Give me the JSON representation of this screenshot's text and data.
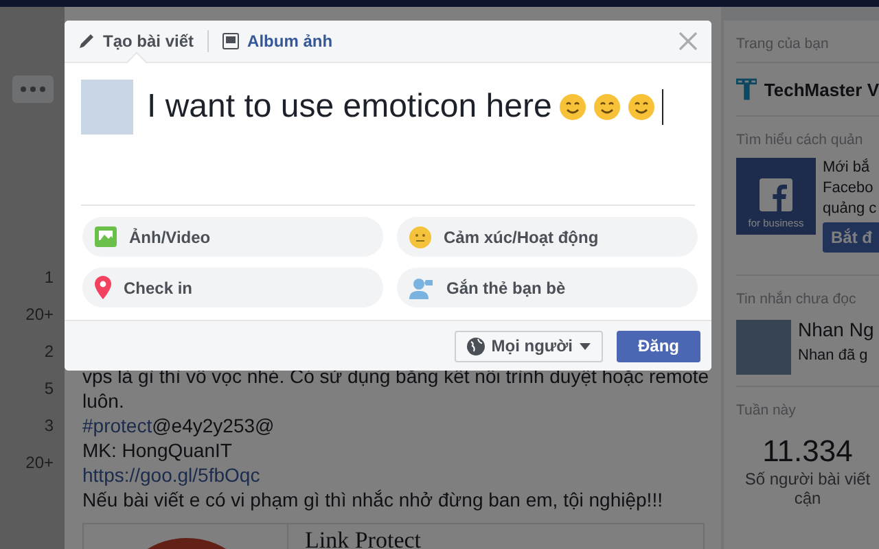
{
  "left_column": {
    "counts": [
      "1",
      "20+",
      "2",
      "5",
      "3",
      "20+"
    ]
  },
  "post": {
    "lines": [
      {
        "kind": "text",
        "text": "vps là gì thì vô vọc nhé. Có sử dụng băng kết nối trình duyệt hoặc remote"
      },
      {
        "kind": "text",
        "text": "luôn."
      },
      {
        "kind": "hashtag",
        "tag": "#protect",
        "text": "@e4y2y253@"
      },
      {
        "kind": "text",
        "text": "MK: HongQuanIT"
      },
      {
        "kind": "link",
        "text": "https://goo.gl/5fbOqc"
      },
      {
        "kind": "text",
        "text": "Nếu bài viết e có vi phạm gì thì nhắc nhở đừng ban em, tội nghiệp!!!"
      }
    ],
    "card_title": "Link Protect"
  },
  "composer": {
    "tabs": [
      {
        "label": "Tạo bài viết",
        "selected": true,
        "kind": "write"
      },
      {
        "label": "Album ảnh",
        "selected": false,
        "kind": "album"
      }
    ],
    "text": "I want to use emoticon here",
    "actions": [
      {
        "label": "Ảnh/Video",
        "kind": "photo"
      },
      {
        "label": "Cảm xúc/Hoạt động",
        "kind": "feeling"
      },
      {
        "label": "Check in",
        "kind": "checkin"
      },
      {
        "label": "Gắn thẻ bạn bè",
        "kind": "tag"
      }
    ],
    "audience": "Mọi người",
    "submit": "Đăng"
  },
  "sidebar": {
    "pages_title": "Trang của bạn",
    "page_name": "TechMaster V",
    "promo_title": "Tìm hiểu cách quản",
    "promo_logo_text": "for business",
    "promo_lines": [
      "Mới bắ",
      "Facebo",
      "quảng c"
    ],
    "promo_button": "Bắt đ",
    "messages_title": "Tin nhắn chưa đọc",
    "message_name": "Nhan Ng",
    "message_preview": "Nhan đã g",
    "week_title": "Tuần này",
    "week_value": "11.334",
    "week_caption": [
      "Số người bài viết",
      "cận"
    ]
  }
}
